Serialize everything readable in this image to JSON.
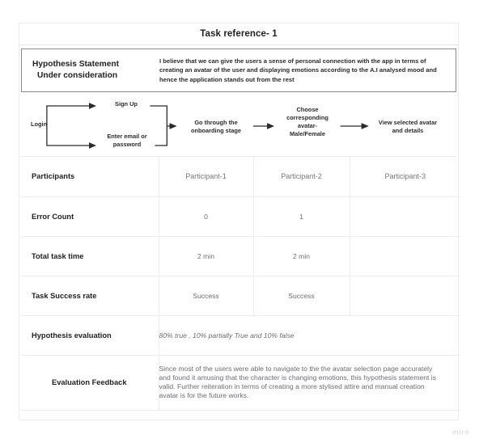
{
  "title": "Task reference- 1",
  "hypothesis": {
    "label_line1": "Hypothesis Statement",
    "label_line2": "Under consideration",
    "statement": "I believe that we can give the users a sense of personal connection with the app in terms of creating an avatar of the user and displaying emotions according to the A.I analysed mood and hence the application stands out from the rest"
  },
  "flow": {
    "start": "Login",
    "branch_top": "Sign Up",
    "branch_bottom": "Enter email or password",
    "step_3": "Go through the onboarding stage",
    "step_4": "Choose corresponding avatar- Male/Female",
    "step_5": "View selected avatar and details"
  },
  "table": {
    "rows": [
      {
        "label": "Participants",
        "v1": "Participant-1",
        "v2": "Participant-2",
        "v3": "Participant-3"
      },
      {
        "label": "Error Count",
        "v1": "0",
        "v2": "1",
        "v3": ""
      },
      {
        "label": "Total task time",
        "v1": "2 min",
        "v2": "2 min",
        "v3": ""
      },
      {
        "label": "Task Success rate",
        "v1": "Success",
        "v2": "Success",
        "v3": ""
      }
    ],
    "evaluation": {
      "label": "Hypothesis evaluation",
      "value": "80% true , 10% partially True and 10% false"
    },
    "feedback": {
      "label": "Evaluation Feedback",
      "value": "Since most of the users were able to navigate to the the avatar selection page accurately and found it amusing that the character is changing emotions, this hypothesis statement is valid. Further reiteration in terms of creating a more stylised attire and manual creation avatar is for the future works."
    }
  },
  "watermark": "miro",
  "colors": {
    "border_light": "#ececee",
    "border_dark": "#8a8a8e",
    "text_primary": "#1f1f1f",
    "text_secondary": "#6c6c72",
    "watermark": "#dededf"
  }
}
